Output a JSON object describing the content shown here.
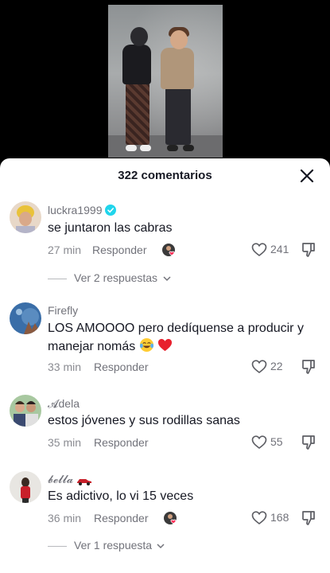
{
  "video": {
    "description_icon": "video-frame"
  },
  "sheet": {
    "title": "322 comentarios",
    "close_icon": "close-icon"
  },
  "comments": [
    {
      "username": "luckra1999",
      "verified": true,
      "text": "se juntaron las cabras",
      "time": "27 min",
      "reply_label": "Responder",
      "creator_liked": true,
      "likes": "241",
      "replies_label": "Ver 2 respuestas"
    },
    {
      "username": "Firefly",
      "text": "LOS AMOOOO pero dedíquense a producir y manejar nomás",
      "emojis": [
        "tears-of-joy-emoji",
        "red-heart-emoji"
      ],
      "time": "33 min",
      "reply_label": "Responder",
      "likes": "22"
    },
    {
      "username": "𝓐dela",
      "text": "estos jóvenes y sus rodillas sanas",
      "time": "35 min",
      "reply_label": "Responder",
      "likes": "55"
    },
    {
      "username": "𝓫𝓮𝓵𝓵𝓪",
      "username_icon": "race-car-icon",
      "text": "Es adictivo, lo vi 15 veces",
      "time": "36 min",
      "reply_label": "Responder",
      "creator_liked": true,
      "likes": "168",
      "replies_label": "Ver 1 respuesta"
    }
  ],
  "colors": {
    "verified": "#20d5ec",
    "heart": "#fe2c55",
    "sheet_bg": "#ffffff"
  }
}
